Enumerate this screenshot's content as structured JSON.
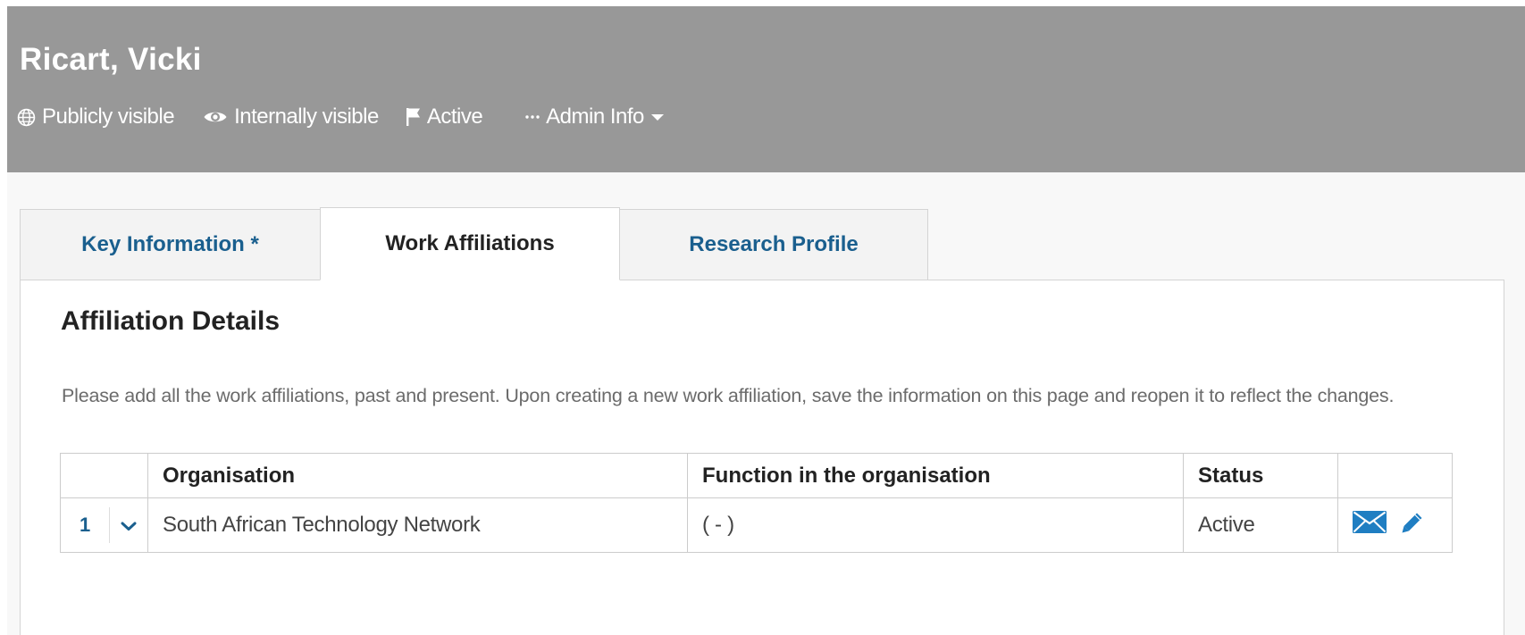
{
  "header": {
    "person_name": "Ricart, Vicki",
    "meta": {
      "public": "Publicly visible",
      "internal": "Internally visible",
      "status": "Active",
      "admin": "Admin Info"
    }
  },
  "tabs": [
    {
      "label": "Key Information *",
      "active": false
    },
    {
      "label": "Work Affiliations",
      "active": true
    },
    {
      "label": "Research Profile",
      "active": false
    }
  ],
  "section": {
    "title": "Affiliation Details",
    "instructions": "Please add all the work affiliations, past and present. Upon creating a new work affiliation, save the information on this page and reopen it to reflect the changes."
  },
  "table": {
    "columns": [
      "",
      "Organisation",
      "Function in the organisation",
      "Status",
      ""
    ],
    "rows": [
      {
        "index": "1",
        "organisation": "South African Technology Network",
        "function": "( - )",
        "status": "Active"
      }
    ]
  },
  "icons": {
    "globe": "globe-icon",
    "eye": "eye-icon",
    "flag": "flag-icon",
    "ellipsis": "ellipsis-icon",
    "caret": "caret-down-icon",
    "chevron": "chevron-down-icon",
    "mail": "envelope-icon",
    "edit": "pencil-icon"
  },
  "colors": {
    "header_bg": "#989898",
    "link_blue": "#1a5f8e",
    "icon_blue": "#1f7ec2"
  }
}
